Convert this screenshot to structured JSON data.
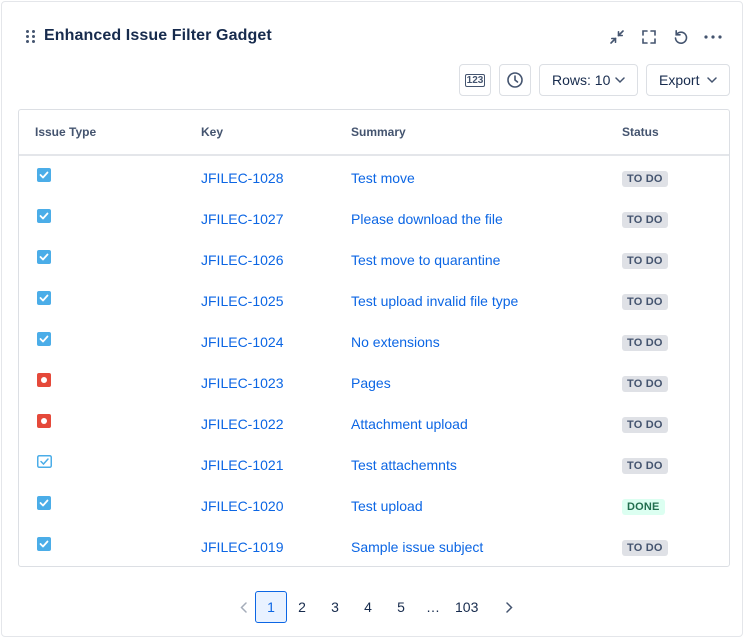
{
  "gadget": {
    "title": "Enhanced Issue Filter Gadget",
    "header_icons": [
      "collapse-icon",
      "fullscreen-icon",
      "refresh-icon",
      "more-icon"
    ]
  },
  "toolbar": {
    "count_label": "123",
    "rows_label": "Rows: 10",
    "export_label": "Export"
  },
  "table": {
    "columns": [
      "Issue Type",
      "Key",
      "Summary",
      "Status"
    ],
    "rows": [
      {
        "type": "task",
        "key": "JFILEC-1028",
        "summary": "Test move",
        "status": "TO DO"
      },
      {
        "type": "task",
        "key": "JFILEC-1027",
        "summary": "Please download the file",
        "status": "TO DO"
      },
      {
        "type": "task",
        "key": "JFILEC-1026",
        "summary": "Test move to quarantine",
        "status": "TO DO"
      },
      {
        "type": "task",
        "key": "JFILEC-1025",
        "summary": "Test upload invalid file type",
        "status": "TO DO"
      },
      {
        "type": "task",
        "key": "JFILEC-1024",
        "summary": "No extensions",
        "status": "TO DO"
      },
      {
        "type": "bug",
        "key": "JFILEC-1023",
        "summary": "Pages",
        "status": "TO DO"
      },
      {
        "type": "bug",
        "key": "JFILEC-1022",
        "summary": "Attachment upload",
        "status": "TO DO"
      },
      {
        "type": "subtask",
        "key": "JFILEC-1021",
        "summary": "Test attachemnts",
        "status": "TO DO"
      },
      {
        "type": "task",
        "key": "JFILEC-1020",
        "summary": "Test upload",
        "status": "DONE"
      },
      {
        "type": "task",
        "key": "JFILEC-1019",
        "summary": "Sample issue subject",
        "status": "TO DO"
      }
    ]
  },
  "pagination": {
    "pages": [
      "1",
      "2",
      "3",
      "4",
      "5",
      "...",
      "103"
    ],
    "current": "1"
  },
  "colors": {
    "task": "#4bade8",
    "bug": "#e5493a",
    "link": "#0c66e4",
    "todo_bg": "#dfe1e6",
    "done_bg": "#dcfff1",
    "done_text": "#216e4e"
  }
}
